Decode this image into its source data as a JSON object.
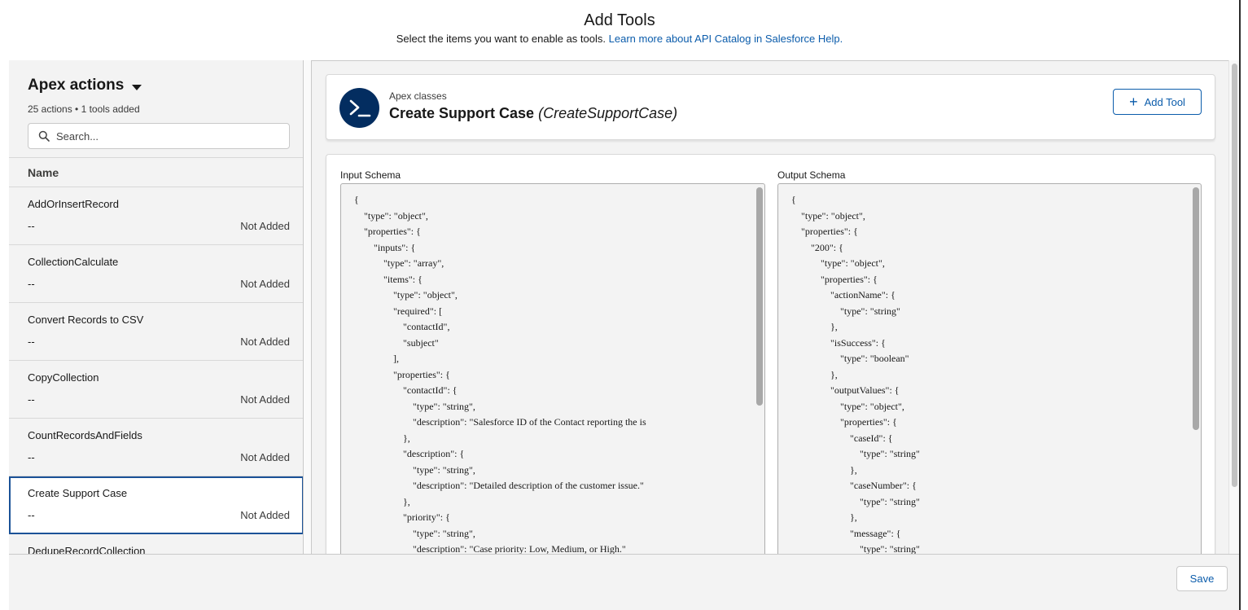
{
  "header": {
    "title": "Add Tools",
    "subtitle": "Select the items you want to enable as tools.",
    "help_link": "Learn more about API Catalog in Salesforce Help."
  },
  "sidebar": {
    "title": "Apex actions",
    "meta": "25 actions • 1 tools added",
    "search_placeholder": "Search...",
    "column_name": "Name",
    "items": [
      {
        "name": "AddOrInsertRecord",
        "detail": "--",
        "status": "Not Added"
      },
      {
        "name": "CollectionCalculate",
        "detail": "--",
        "status": "Not Added"
      },
      {
        "name": "Convert Records to CSV",
        "detail": "--",
        "status": "Not Added"
      },
      {
        "name": "CopyCollection",
        "detail": "--",
        "status": "Not Added"
      },
      {
        "name": "CountRecordsAndFields",
        "detail": "--",
        "status": "Not Added"
      },
      {
        "name": "Create Support Case",
        "detail": "--",
        "status": "Not Added"
      },
      {
        "name": "DedupeRecordCollection",
        "detail": "",
        "status": ""
      }
    ]
  },
  "detail": {
    "kind": "Apex classes",
    "label": "Create Support Case",
    "api_name": "(CreateSupportCase)",
    "add_button": "Add Tool",
    "icon": "terminal-icon",
    "input_label": "Input Schema",
    "output_label": "Output Schema",
    "input_schema": "{\n    \"type\": \"object\",\n    \"properties\": {\n        \"inputs\": {\n            \"type\": \"array\",\n            \"items\": {\n                \"type\": \"object\",\n                \"required\": [\n                    \"contactId\",\n                    \"subject\"\n                ],\n                \"properties\": {\n                    \"contactId\": {\n                        \"type\": \"string\",\n                        \"description\": \"Salesforce ID of the Contact reporting the is\n                    },\n                    \"description\": {\n                        \"type\": \"string\",\n                        \"description\": \"Detailed description of the customer issue.\"\n                    },\n                    \"priority\": {\n                        \"type\": \"string\",\n                        \"description\": \"Case priority: Low, Medium, or High.\"",
    "output_schema": "{\n    \"type\": \"object\",\n    \"properties\": {\n        \"200\": {\n            \"type\": \"object\",\n            \"properties\": {\n                \"actionName\": {\n                    \"type\": \"string\"\n                },\n                \"isSuccess\": {\n                    \"type\": \"boolean\"\n                },\n                \"outputValues\": {\n                    \"type\": \"object\",\n                    \"properties\": {\n                        \"caseId\": {\n                            \"type\": \"string\"\n                        },\n                        \"caseNumber\": {\n                            \"type\": \"string\"\n                        },\n                        \"message\": {\n                            \"type\": \"string\""
  },
  "footer": {
    "save_label": "Save"
  },
  "colors": {
    "brand_blue": "#0b5cab",
    "icon_navy": "#032d60",
    "selection_border": "#1b5297"
  }
}
